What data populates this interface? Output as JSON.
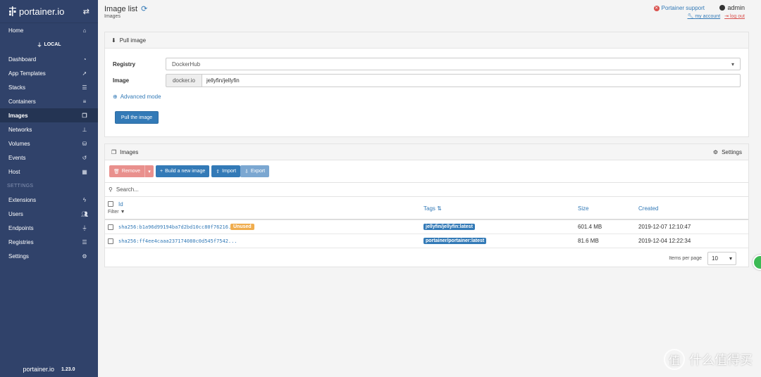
{
  "brand": {
    "name": "portainer.io"
  },
  "sidebar": {
    "items_top": [
      {
        "label": "Home",
        "icon": "home-icon"
      }
    ],
    "local_label": "LOCAL",
    "items": [
      {
        "label": "Dashboard",
        "icon": "tachometer-icon"
      },
      {
        "label": "App Templates",
        "icon": "rocket-icon"
      },
      {
        "label": "Stacks",
        "icon": "th-list-icon"
      },
      {
        "label": "Containers",
        "icon": "server-icon"
      },
      {
        "label": "Images",
        "icon": "clone-icon"
      },
      {
        "label": "Networks",
        "icon": "sitemap-icon"
      },
      {
        "label": "Volumes",
        "icon": "cubes-icon"
      },
      {
        "label": "Events",
        "icon": "history-icon"
      },
      {
        "label": "Host",
        "icon": "th-icon"
      }
    ],
    "settings_section": "SETTINGS",
    "settings_items": [
      {
        "label": "Extensions",
        "icon": "bolt-icon"
      },
      {
        "label": "Users",
        "icon": "users-icon"
      },
      {
        "label": "Endpoints",
        "icon": "plug-icon"
      },
      {
        "label": "Registries",
        "icon": "database-icon"
      },
      {
        "label": "Settings",
        "icon": "cogs-icon"
      }
    ],
    "footer_brand": "portainer.io",
    "version": "1.23.0"
  },
  "header": {
    "title": "Image list",
    "breadcrumb": "Images",
    "support": "Portainer support",
    "user": "admin",
    "my_account": "my account",
    "log_out": "log out"
  },
  "pull": {
    "title": "Pull image",
    "registry_label": "Registry",
    "registry_value": "DockerHub",
    "image_label": "Image",
    "image_prefix": "docker.io",
    "image_value": "jellyfin/jellyfin",
    "advanced": "Advanced mode",
    "pull_button": "Pull the image"
  },
  "images": {
    "title": "Images",
    "settings": "Settings",
    "buttons": {
      "remove": "Remove",
      "build": "Build a new image",
      "import": "Import",
      "export": "Export"
    },
    "search_placeholder": "Search...",
    "columns": {
      "id": "Id",
      "filter": "Filter",
      "tags": "Tags",
      "size": "Size",
      "created": "Created"
    },
    "rows": [
      {
        "id": "sha256:b1a96d99194ba7d2bd10cc80f76216...",
        "badge": "Unused",
        "tag": "jellyfin/jellyfin:latest",
        "size": "601.4 MB",
        "created": "2019-12-07 12:10:47"
      },
      {
        "id": "sha256:ff4ee4caaa237174080c0d545f7542...",
        "badge": "",
        "tag": "portainer/portainer:latest",
        "size": "81.6 MB",
        "created": "2019-12-04 12:22:34"
      }
    ],
    "items_per_page_label": "Items per page",
    "items_per_page_value": "10"
  },
  "watermark": {
    "text": "什么值得买",
    "mark": "值"
  }
}
